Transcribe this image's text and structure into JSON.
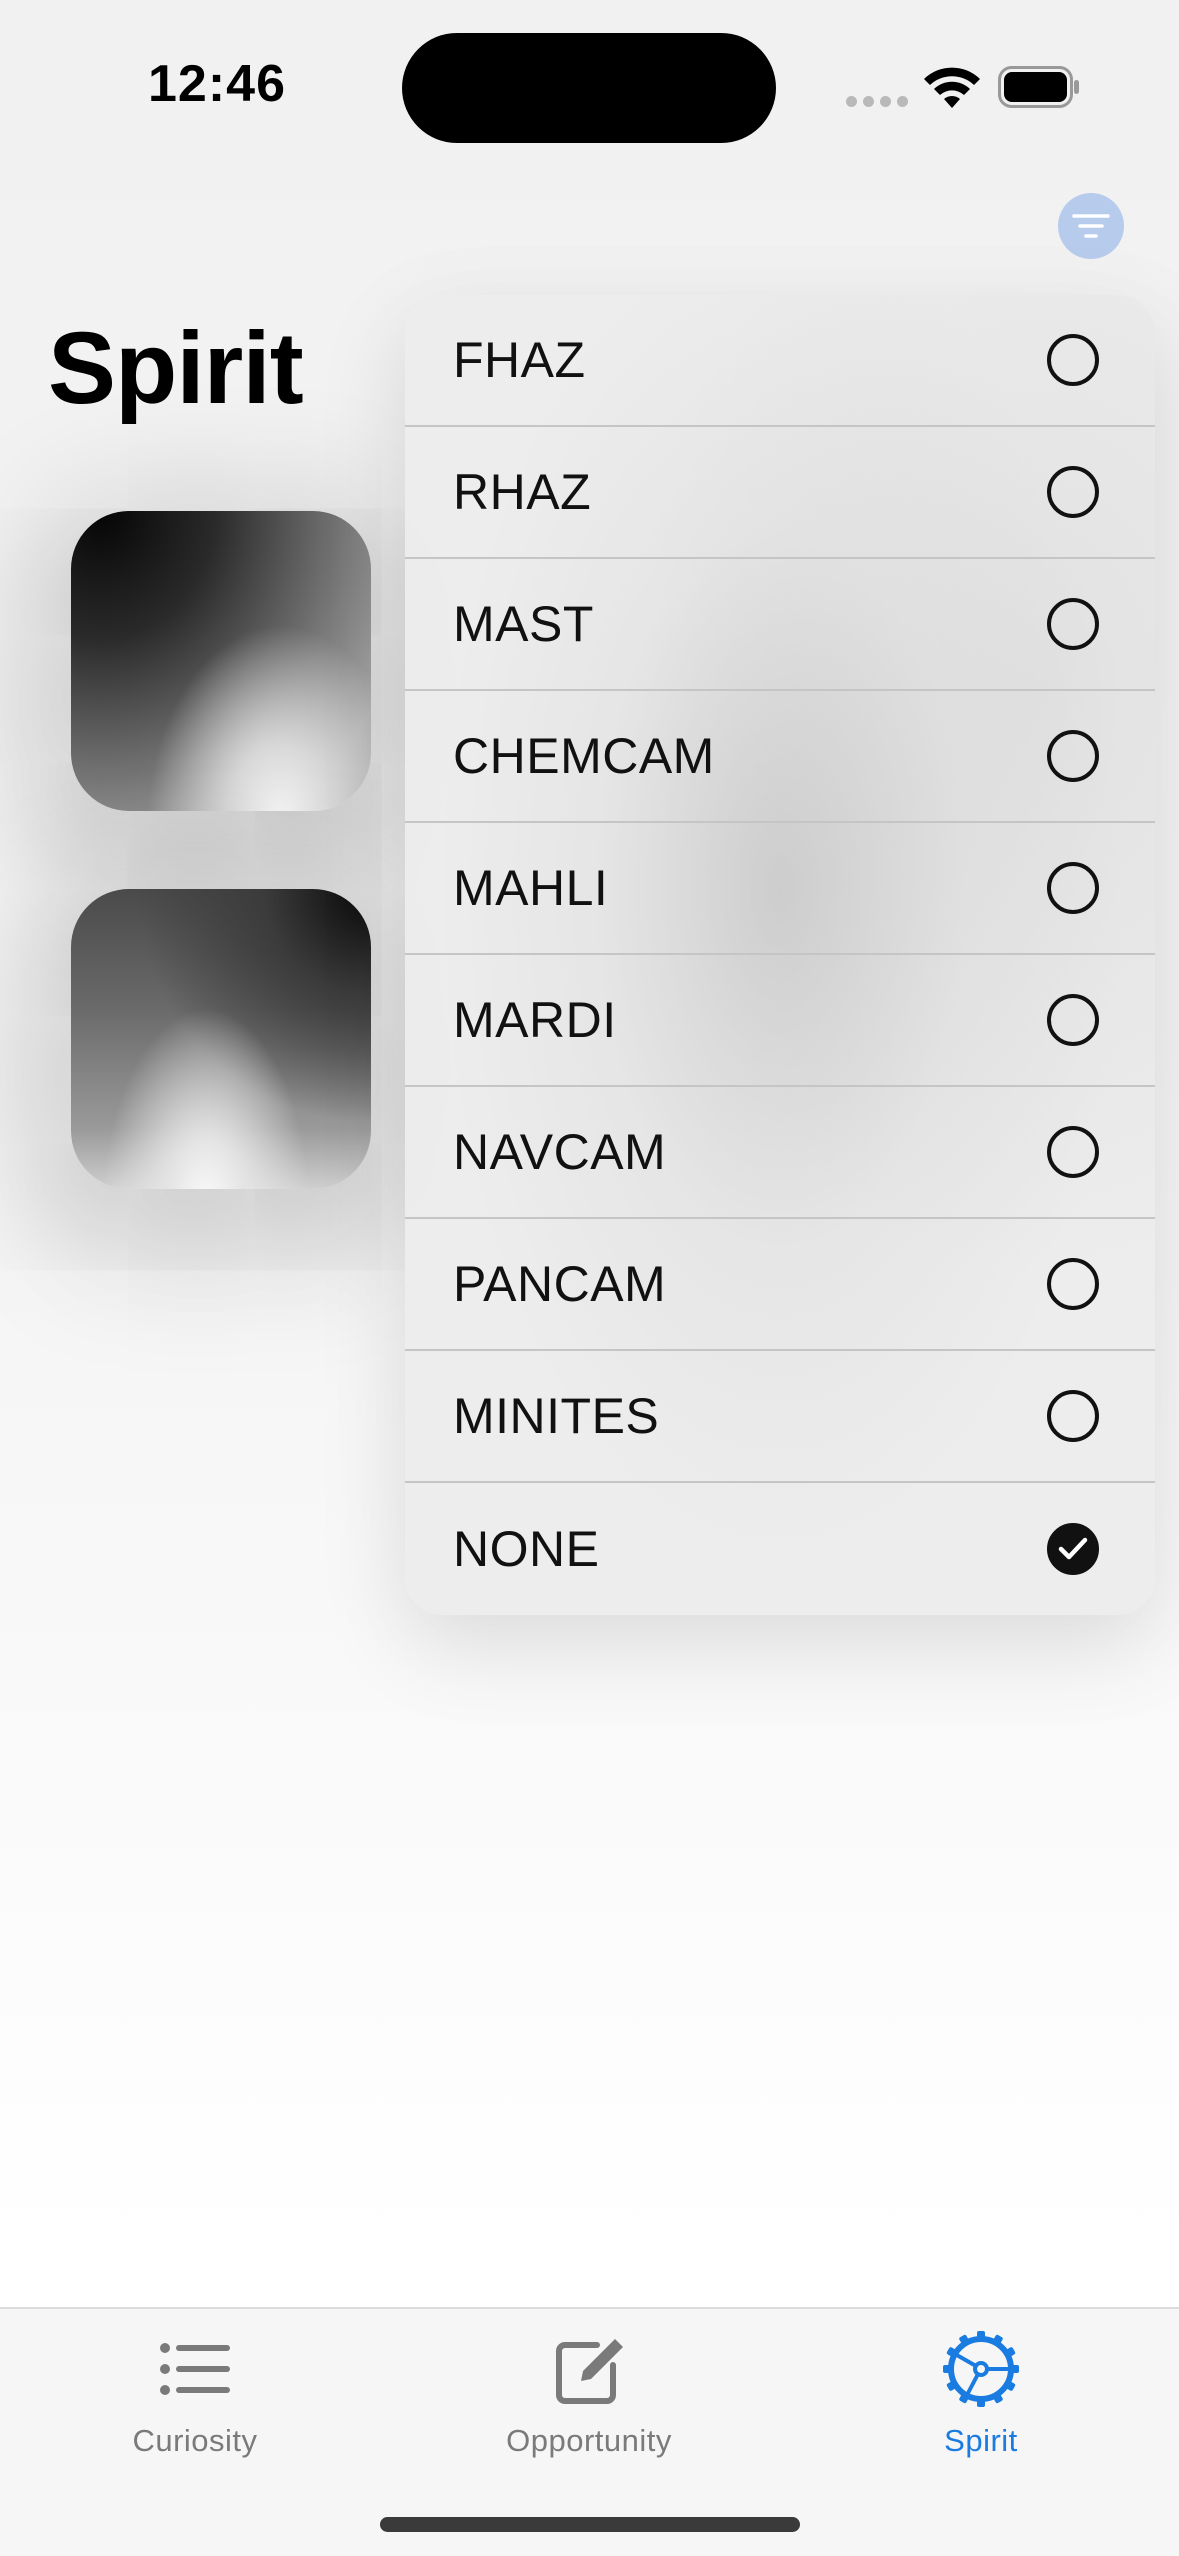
{
  "status_bar": {
    "time": "12:46"
  },
  "page": {
    "title": "Spirit"
  },
  "filter_menu": {
    "items": [
      {
        "label": "FHAZ",
        "selected": false
      },
      {
        "label": "RHAZ",
        "selected": false
      },
      {
        "label": "MAST",
        "selected": false
      },
      {
        "label": "CHEMCAM",
        "selected": false
      },
      {
        "label": "MAHLI",
        "selected": false
      },
      {
        "label": "MARDI",
        "selected": false
      },
      {
        "label": "NAVCAM",
        "selected": false
      },
      {
        "label": "PANCAM",
        "selected": false
      },
      {
        "label": "MINITES",
        "selected": false
      },
      {
        "label": "NONE",
        "selected": true
      }
    ]
  },
  "tab_bar": {
    "tabs": [
      {
        "label": "Curiosity",
        "icon": "list-icon",
        "active": false
      },
      {
        "label": "Opportunity",
        "icon": "compose-icon",
        "active": false
      },
      {
        "label": "Spirit",
        "icon": "gear-icon",
        "active": true
      }
    ]
  },
  "colors": {
    "accent": "#1a7ce0",
    "filter_button": "#b7cbed",
    "inactive_tab": "#7a7a7a"
  }
}
